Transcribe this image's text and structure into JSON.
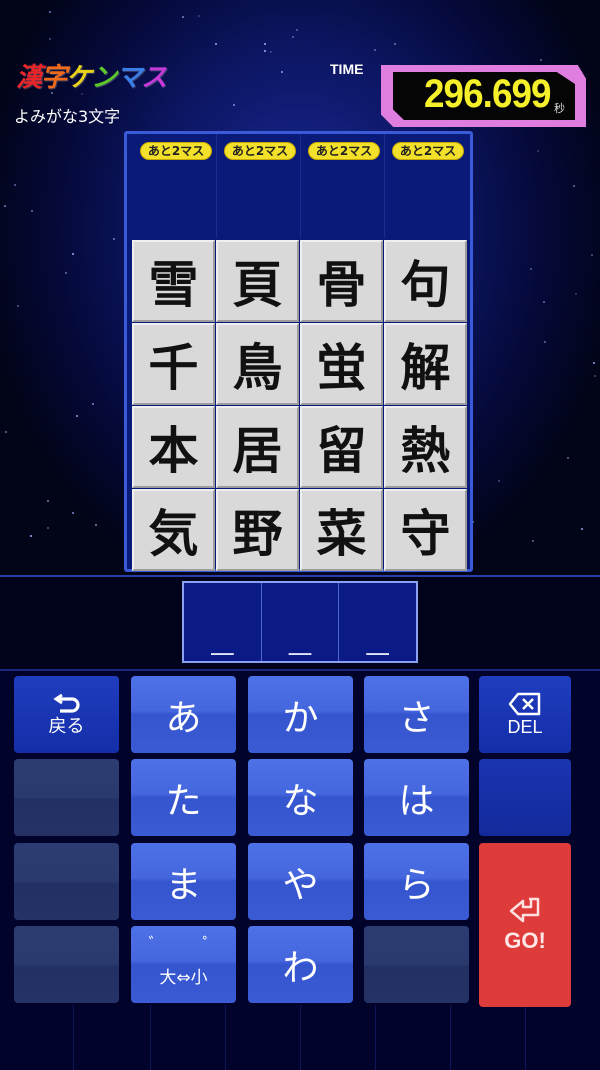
{
  "header": {
    "logo": {
      "text": "漢字ケンマス",
      "chars": [
        {
          "ch": "漢",
          "color": "#e8262a"
        },
        {
          "ch": "字",
          "color": "#f06a1c"
        },
        {
          "ch": "ケ",
          "color": "#e8d21a"
        },
        {
          "ch": "ン",
          "color": "#5ec82a"
        },
        {
          "ch": "マ",
          "color": "#3a7ee8"
        },
        {
          "ch": "ス",
          "color": "#c83ad8"
        }
      ]
    },
    "subtitle": "よみがな3文字",
    "timer": {
      "label": "TIME",
      "value": "296.699",
      "unit": "秒"
    }
  },
  "board": {
    "column_badges": [
      "あと2マス",
      "あと2マス",
      "あと2マス",
      "あと2マス"
    ],
    "tiles": [
      [
        "雪",
        "頁",
        "骨",
        "句"
      ],
      [
        "千",
        "鳥",
        "蛍",
        "解"
      ],
      [
        "本",
        "居",
        "留",
        "熱"
      ],
      [
        "気",
        "野",
        "菜",
        "守"
      ]
    ]
  },
  "answer": {
    "slot_count": 3,
    "slots": [
      "＿",
      "＿",
      "＿"
    ]
  },
  "keyboard": {
    "back": {
      "icon": "back-arrow-icon",
      "label": "戻る"
    },
    "delete": {
      "icon": "backspace-icon",
      "label": "DEL"
    },
    "go": {
      "icon": "enter-arrow-icon",
      "label": "GO!"
    },
    "kana_keys": [
      "あ",
      "か",
      "さ",
      "た",
      "な",
      "は",
      "ま",
      "や",
      "ら",
      "わ"
    ],
    "modifier": {
      "dakuten": "゛",
      "handakuten": "゜",
      "label": "大⇔小"
    }
  },
  "colors": {
    "timer_digits": "#f6f02a",
    "timer_frame": "#e07ee0",
    "badge": "#f2e02a",
    "go_button": "#dd3c3a",
    "kana_key": "#4567de"
  }
}
